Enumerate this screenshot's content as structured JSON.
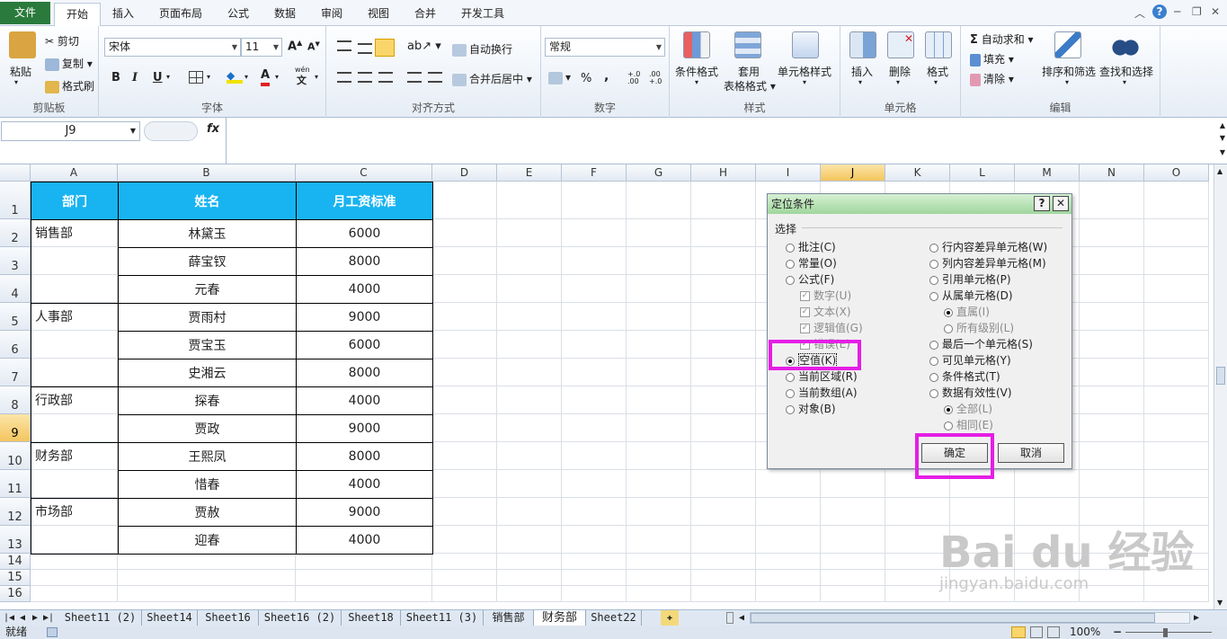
{
  "tabs": {
    "file": "文件",
    "items": [
      "开始",
      "插入",
      "页面布局",
      "公式",
      "数据",
      "审阅",
      "视图",
      "合并",
      "开发工具"
    ]
  },
  "ribbon": {
    "clipboard": {
      "paste": "粘贴",
      "cut": "剪切",
      "copy": "复制",
      "painter": "格式刷",
      "label": "剪贴板"
    },
    "font": {
      "name": "宋体",
      "size": "11",
      "label": "字体",
      "bold": "B",
      "italic": "I",
      "underline": "U",
      "grow": "A",
      "shrink": "A",
      "color_a": "A",
      "wen": "wén"
    },
    "align": {
      "wrap": "自动换行",
      "merge": "合并后居中",
      "label": "对齐方式"
    },
    "number": {
      "format": "常规",
      "percent": "%",
      "comma": ",",
      "label": "数字",
      "inc": "+.0 .00",
      "dec": ".00 +.0"
    },
    "styles": {
      "cond": "条件格式",
      "table1": "套用",
      "table2": "表格格式",
      "cellstyle": "单元格样式",
      "label": "样式"
    },
    "cells": {
      "insert": "插入",
      "delete": "删除",
      "format": "格式",
      "label": "单元格"
    },
    "edit": {
      "autosum": "自动求和",
      "fill": "填充",
      "clear": "清除",
      "sort": "排序和筛选",
      "find": "查找和选择",
      "label": "编辑",
      "sigma": "Σ"
    }
  },
  "formula": {
    "namebox": "J9",
    "fx": "fx"
  },
  "columns": [
    "A",
    "B",
    "C",
    "D",
    "E",
    "F",
    "G",
    "H",
    "I",
    "J",
    "K",
    "L",
    "M",
    "N",
    "O"
  ],
  "rows": [
    "1",
    "2",
    "3",
    "4",
    "5",
    "6",
    "7",
    "8",
    "9",
    "10",
    "11",
    "12",
    "13",
    "14",
    "15",
    "16"
  ],
  "table": {
    "headers": [
      "部门",
      "姓名",
      "月工资标准"
    ],
    "depts": [
      "销售部",
      "人事部",
      "行政部",
      "财务部",
      "市场部"
    ],
    "names": [
      "林黛玉",
      "薛宝钗",
      "元春",
      "贾雨村",
      "贾宝玉",
      "史湘云",
      "探春",
      "贾政",
      "王熙凤",
      "惜春",
      "贾赦",
      "迎春"
    ],
    "salaries": [
      "6000",
      "8000",
      "4000",
      "9000",
      "6000",
      "8000",
      "4000",
      "9000",
      "8000",
      "4000",
      "9000",
      "4000"
    ]
  },
  "dialog": {
    "title": "定位条件",
    "help": "?",
    "close": "✕",
    "section": "选择",
    "left": [
      "批注(C)",
      "常量(O)",
      "公式(F)",
      "数字(U)",
      "文本(X)",
      "逻辑值(G)",
      "错误(E)",
      "空值(K)",
      "当前区域(R)",
      "当前数组(A)",
      "对象(B)"
    ],
    "right": [
      "行内容差异单元格(W)",
      "列内容差异单元格(M)",
      "引用单元格(P)",
      "从属单元格(D)",
      "直属(I)",
      "所有级别(L)",
      "最后一个单元格(S)",
      "可见单元格(Y)",
      "条件格式(T)",
      "数据有效性(V)",
      "全部(L)",
      "相同(E)"
    ],
    "ok": "确定",
    "cancel": "取消"
  },
  "sheets": [
    "Sheet11 (2)",
    "Sheet14",
    "Sheet16",
    "Sheet16 (2)",
    "Sheet18",
    "Sheet11 (3)",
    "销售部",
    "财务部",
    "Sheet22"
  ],
  "status": {
    "ready": "就绪",
    "zoom": "100%",
    "minus": "−"
  },
  "watermark": {
    "main": "Bai du 经验",
    "url": "jingyan.baidu.com"
  }
}
